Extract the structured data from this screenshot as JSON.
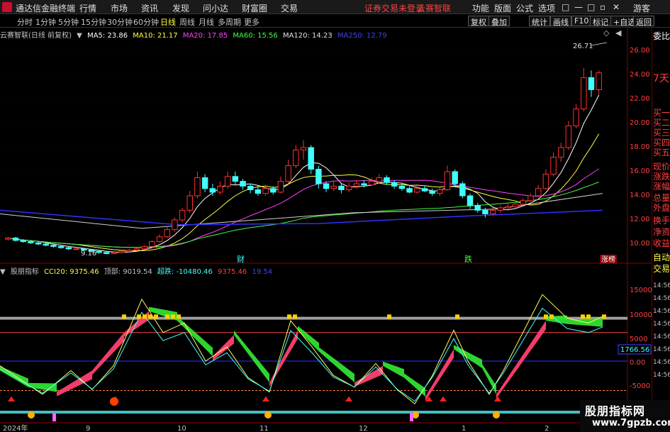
{
  "topbar": {
    "title": "通达信金融终端",
    "menus": [
      "行情",
      "市场",
      "资讯",
      "发现",
      "问小达",
      "财富圈",
      "交易"
    ],
    "status": "证券交易未登录",
    "stock_name": "云赛智联",
    "right_menus": [
      "功能",
      "版面",
      "公式",
      "选项"
    ],
    "guest": "游客"
  },
  "periodbar": {
    "periods": [
      "分时",
      "1分钟",
      "5分钟",
      "15分钟",
      "30分钟",
      "60分钟",
      "日线",
      "周线",
      "月线",
      "多周期",
      "更多"
    ],
    "active": "日线",
    "right_buttons": [
      "复权",
      "叠加",
      "统计",
      "画线",
      "F10",
      "标记",
      "+自选",
      "返回"
    ]
  },
  "main_chart": {
    "name": "云赛智联(日线 前复权)",
    "ma": [
      {
        "label": "MA5: 23.86",
        "color": "#ffffff"
      },
      {
        "label": "MA10: 21.17",
        "color": "#ffff40"
      },
      {
        "label": "MA20: 17.85",
        "color": "#ff40ff"
      },
      {
        "label": "MA60: 15.56",
        "color": "#40ff40"
      },
      {
        "label": "MA120: 14.23",
        "color": "#e0e0e0"
      },
      {
        "label": "MA250: 12.79",
        "color": "#4040ff"
      }
    ],
    "y_ticks": [
      "26.00",
      "24.00",
      "22.00",
      "20.00",
      "18.00",
      "16.00",
      "14.00",
      "12.00",
      "10.00"
    ],
    "high_label": "26.71",
    "low_label": "9.16",
    "markers": [
      "财",
      "跌",
      "涨榜"
    ]
  },
  "indicator": {
    "name": "股朋指标",
    "values": [
      {
        "label": "CCI20: 9375.46",
        "color": "#ffff40"
      },
      {
        "label": "顶部: 9019.54",
        "color": "#c0c0c0"
      },
      {
        "label": "超跌: -10480.46",
        "color": "#40ffff"
      },
      {
        "label": "9375.46",
        "color": "#ff4040"
      },
      {
        "label": "19.54",
        "color": "#4040ff"
      }
    ],
    "y_ticks": [
      "15000",
      "10000",
      "5000",
      "0.00",
      "-5000"
    ],
    "current_value": "1766.56"
  },
  "x_axis": [
    "2024年",
    "9",
    "10",
    "11",
    "12",
    "1",
    "2"
  ],
  "right_panel": {
    "items": [
      "委比",
      "7天",
      "买一",
      "买二",
      "买三",
      "买四",
      "买五",
      "现价",
      "涨跌",
      "涨幅",
      "总量",
      "外盘",
      "换手",
      "净资",
      "收益",
      "自动",
      "交易"
    ],
    "times": [
      "14:56",
      "14:56",
      "14:56",
      "14:56",
      "14:56",
      "14:56",
      "14:56",
      "14:56"
    ]
  },
  "watermark": {
    "line1": "股朋指标网",
    "line2": "www.7gpzb.com"
  },
  "chart_data": {
    "type": "candlestick",
    "title": "云赛智联(日线 前复权)",
    "ylim": [
      9,
      27
    ],
    "candles": [
      [
        10.4,
        10.5,
        10.3,
        10.6
      ],
      [
        10.5,
        10.3,
        10.2,
        10.6
      ],
      [
        10.3,
        10.2,
        10.1,
        10.4
      ],
      [
        10.2,
        10.1,
        10.0,
        10.3
      ],
      [
        10.1,
        10.0,
        9.9,
        10.2
      ],
      [
        10.0,
        9.9,
        9.8,
        10.1
      ],
      [
        9.9,
        9.8,
        9.7,
        10.0
      ],
      [
        9.8,
        9.7,
        9.6,
        9.9
      ],
      [
        9.7,
        9.6,
        9.5,
        9.8
      ],
      [
        9.6,
        9.6,
        9.5,
        9.7
      ],
      [
        9.6,
        9.5,
        9.4,
        9.7
      ],
      [
        9.5,
        9.4,
        9.3,
        9.6
      ],
      [
        9.4,
        9.3,
        9.2,
        9.5
      ],
      [
        9.3,
        9.2,
        9.16,
        9.4
      ],
      [
        9.2,
        9.3,
        9.16,
        9.4
      ],
      [
        9.3,
        9.4,
        9.2,
        9.5
      ],
      [
        9.4,
        9.5,
        9.3,
        9.6
      ],
      [
        9.5,
        9.6,
        9.4,
        9.7
      ],
      [
        9.6,
        9.8,
        9.5,
        9.9
      ],
      [
        9.8,
        10.2,
        9.7,
        10.3
      ],
      [
        10.2,
        10.6,
        10.1,
        10.8
      ],
      [
        10.6,
        11.2,
        10.5,
        11.4
      ],
      [
        11.2,
        12.0,
        11.0,
        12.2
      ],
      [
        12.0,
        12.8,
        11.8,
        13.0
      ],
      [
        12.8,
        14.0,
        12.6,
        14.4
      ],
      [
        14.0,
        15.5,
        13.8,
        16.0
      ],
      [
        15.5,
        14.6,
        14.3,
        15.8
      ],
      [
        14.6,
        14.3,
        14.0,
        15.0
      ],
      [
        14.3,
        14.8,
        14.1,
        15.2
      ],
      [
        14.8,
        15.6,
        14.6,
        16.0
      ],
      [
        15.6,
        15.2,
        14.9,
        16.0
      ],
      [
        15.2,
        14.8,
        14.5,
        15.4
      ],
      [
        14.8,
        14.5,
        14.2,
        15.0
      ],
      [
        14.5,
        14.2,
        14.0,
        14.8
      ],
      [
        14.2,
        14.6,
        14.0,
        14.9
      ],
      [
        14.6,
        14.3,
        14.1,
        14.8
      ],
      [
        14.3,
        15.2,
        14.2,
        15.6
      ],
      [
        15.2,
        16.5,
        15.0,
        17.0
      ],
      [
        16.5,
        17.8,
        16.3,
        18.2
      ],
      [
        17.8,
        18.0,
        17.0,
        18.6
      ],
      [
        18.0,
        16.2,
        15.8,
        18.2
      ],
      [
        16.2,
        15.0,
        14.6,
        16.5
      ],
      [
        15.0,
        14.6,
        14.3,
        15.2
      ],
      [
        14.6,
        14.8,
        14.4,
        15.2
      ],
      [
        14.8,
        14.5,
        14.2,
        15.0
      ],
      [
        14.5,
        14.8,
        14.3,
        15.1
      ],
      [
        14.8,
        15.0,
        14.6,
        15.3
      ],
      [
        15.0,
        14.9,
        14.7,
        15.3
      ],
      [
        14.9,
        15.2,
        14.8,
        15.5
      ],
      [
        15.2,
        15.5,
        15.0,
        15.8
      ],
      [
        15.5,
        15.1,
        14.9,
        15.7
      ],
      [
        15.1,
        14.8,
        14.6,
        15.3
      ],
      [
        14.8,
        14.6,
        14.4,
        15.0
      ],
      [
        14.6,
        14.3,
        14.2,
        14.8
      ],
      [
        14.3,
        14.6,
        14.2,
        14.8
      ],
      [
        14.6,
        14.4,
        14.3,
        14.8
      ],
      [
        14.4,
        14.2,
        14.0,
        14.6
      ],
      [
        14.2,
        14.5,
        14.0,
        14.7
      ],
      [
        14.5,
        16.0,
        14.4,
        16.5
      ],
      [
        16.0,
        15.0,
        14.7,
        16.2
      ],
      [
        15.0,
        14.0,
        13.8,
        15.2
      ],
      [
        14.0,
        13.2,
        12.9,
        14.2
      ],
      [
        13.2,
        12.8,
        12.6,
        13.4
      ],
      [
        12.8,
        12.5,
        12.2,
        13.0
      ],
      [
        12.5,
        12.8,
        12.4,
        13.0
      ],
      [
        12.8,
        13.0,
        12.6,
        13.2
      ],
      [
        13.0,
        13.1,
        12.9,
        13.3
      ],
      [
        13.1,
        13.3,
        13.0,
        13.5
      ],
      [
        13.3,
        13.6,
        13.2,
        13.8
      ],
      [
        13.6,
        14.0,
        13.5,
        14.2
      ],
      [
        14.0,
        14.6,
        13.9,
        14.9
      ],
      [
        14.6,
        15.8,
        14.5,
        16.2
      ],
      [
        15.8,
        17.2,
        15.6,
        17.6
      ],
      [
        17.2,
        18.0,
        16.8,
        18.4
      ],
      [
        18.0,
        19.8,
        17.8,
        20.2
      ],
      [
        19.8,
        21.2,
        19.6,
        21.6
      ],
      [
        21.2,
        23.8,
        21.0,
        24.6
      ],
      [
        23.8,
        22.8,
        22.2,
        24.4
      ],
      [
        22.8,
        24.2,
        22.4,
        24.4
      ]
    ],
    "cci20_last": 9375.46,
    "top_line": 9019.54,
    "oversold": -10480.46
  }
}
